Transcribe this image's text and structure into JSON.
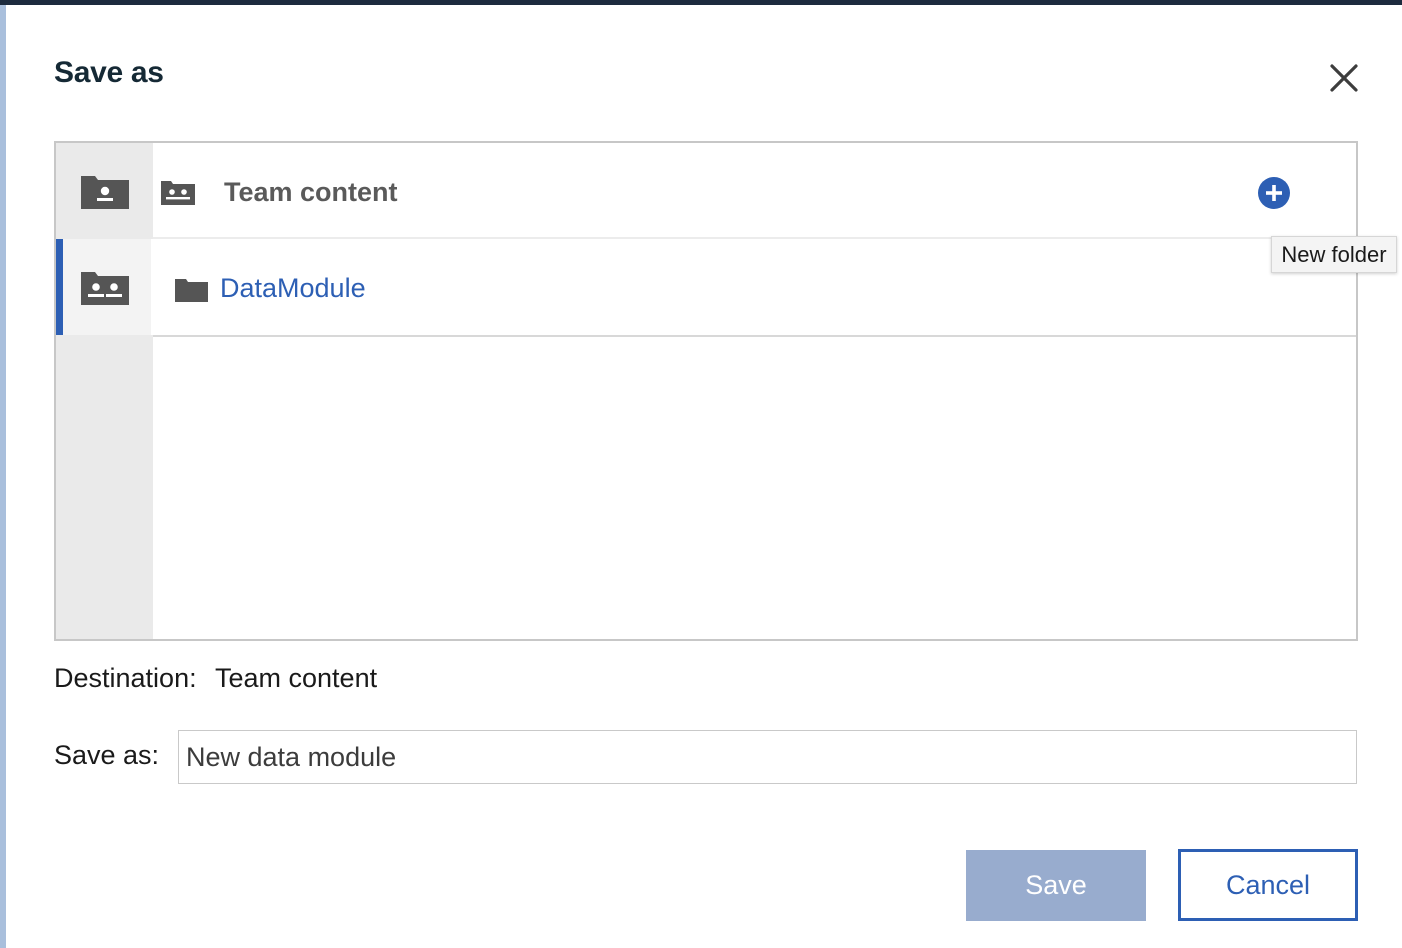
{
  "dialog": {
    "title": "Save as",
    "close_icon": "close-icon"
  },
  "browser": {
    "rail": [
      {
        "icon": "personal-folder-icon",
        "selected": false
      },
      {
        "icon": "team-folder-icon",
        "selected": true
      }
    ],
    "header": {
      "icon": "team-folder-icon",
      "title": "Team content",
      "action_icon": "add-circle-icon"
    },
    "items": [
      {
        "icon": "folder-icon",
        "name": "DataModule"
      }
    ],
    "tooltip": "New folder"
  },
  "destination": {
    "label": "Destination:",
    "value": "Team content"
  },
  "save_as": {
    "label": "Save as:",
    "value": "New data module"
  },
  "buttons": {
    "save": "Save",
    "cancel": "Cancel"
  },
  "colors": {
    "accent": "#2d5fb4",
    "save_disabled": "#98acce",
    "title": "#152935",
    "rail_bg": "#eaeaea"
  }
}
